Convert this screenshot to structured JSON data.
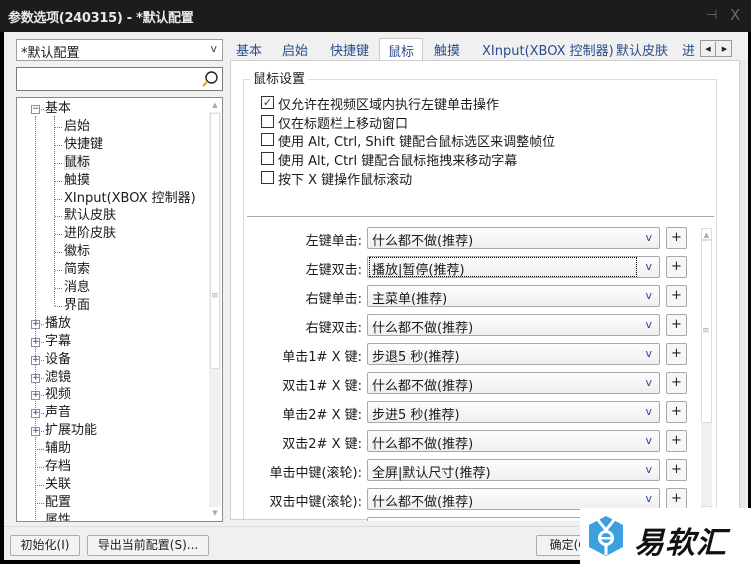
{
  "window": {
    "title": "参数选项(240315) - *默认配置",
    "pin_icon": "pin-icon",
    "close_icon": "close-icon",
    "pin_glyph": "⊣",
    "close_glyph": "X"
  },
  "sidebar": {
    "profile": {
      "value": "*默认配置",
      "arrow": "v"
    },
    "search": {
      "value": "",
      "placeholder": "",
      "icon": "search-icon"
    },
    "tree": [
      {
        "label": "基本",
        "level": 0,
        "expander": "-"
      },
      {
        "label": "启始",
        "level": 1
      },
      {
        "label": "快捷键",
        "level": 1
      },
      {
        "label": "鼠标",
        "level": 1,
        "selected": true
      },
      {
        "label": "触摸",
        "level": 1
      },
      {
        "label": "XInput(XBOX 控制器)",
        "level": 1
      },
      {
        "label": "默认皮肤",
        "level": 1
      },
      {
        "label": "进阶皮肤",
        "level": 1
      },
      {
        "label": "徽标",
        "level": 1
      },
      {
        "label": "简索",
        "level": 1
      },
      {
        "label": "消息",
        "level": 1
      },
      {
        "label": "界面",
        "level": 1
      },
      {
        "label": "播放",
        "level": 0,
        "expander": "+"
      },
      {
        "label": "字幕",
        "level": 0,
        "expander": "+"
      },
      {
        "label": "设备",
        "level": 0,
        "expander": "+"
      },
      {
        "label": "滤镜",
        "level": 0,
        "expander": "+"
      },
      {
        "label": "视频",
        "level": 0,
        "expander": "+"
      },
      {
        "label": "声音",
        "level": 0,
        "expander": "+"
      },
      {
        "label": "扩展功能",
        "level": 0,
        "expander": "+"
      },
      {
        "label": "辅助",
        "level": 0
      },
      {
        "label": "存档",
        "level": 0
      },
      {
        "label": "关联",
        "level": 0
      },
      {
        "label": "配置",
        "level": 0
      },
      {
        "label": "属性",
        "level": 0
      }
    ]
  },
  "tabs": {
    "items": [
      "基本",
      "启始",
      "快捷键",
      "鼠标",
      "触摸",
      "XInput(XBOX 控制器)",
      "默认皮肤",
      "进"
    ],
    "active": "鼠标",
    "scroll_left": "◀",
    "scroll_right": "▶"
  },
  "mouse_settings": {
    "group_title": "鼠标设置",
    "checkboxes": [
      {
        "label": "仅允许在视频区域内执行左键单击操作",
        "checked": true
      },
      {
        "label": "仅在标题栏上移动窗口",
        "checked": false
      },
      {
        "label": "使用 Alt, Ctrl, Shift 键配合鼠标选区来调整帧位",
        "checked": false
      },
      {
        "label": "使用 Alt, Ctrl 键配合鼠标拖拽来移动字幕",
        "checked": false
      },
      {
        "label": "按下 X 键操作鼠标滚动",
        "checked": false
      }
    ],
    "actions": [
      {
        "label": "左键单击:",
        "value": "什么都不做(推荐)"
      },
      {
        "label": "左键双击:",
        "value": "播放|暂停(推荐)",
        "focused": true
      },
      {
        "label": "右键单击:",
        "value": "主菜单(推荐)"
      },
      {
        "label": "右键双击:",
        "value": "什么都不做(推荐)"
      },
      {
        "label": "单击1# X 键:",
        "value": "步退5 秒(推荐)"
      },
      {
        "label": "双击1# X 键:",
        "value": "什么都不做(推荐)"
      },
      {
        "label": "单击2# X 键:",
        "value": "步进5 秒(推荐)"
      },
      {
        "label": "双击2# X 键:",
        "value": "什么都不做(推荐)"
      },
      {
        "label": "单击中键(滚轮):",
        "value": "全屏|默认尺寸(推荐)"
      },
      {
        "label": "双击中键(滚轮):",
        "value": "什么都不做(推荐)"
      }
    ],
    "dropdown_arrow": "v",
    "add_label": "+"
  },
  "footer": {
    "init_button": "初始化(I)",
    "export_button": "导出当前配置(S)...",
    "ok_button": "确定(O)"
  },
  "watermark": {
    "brand": "易软汇",
    "brand_color": "#3aa0e0"
  }
}
